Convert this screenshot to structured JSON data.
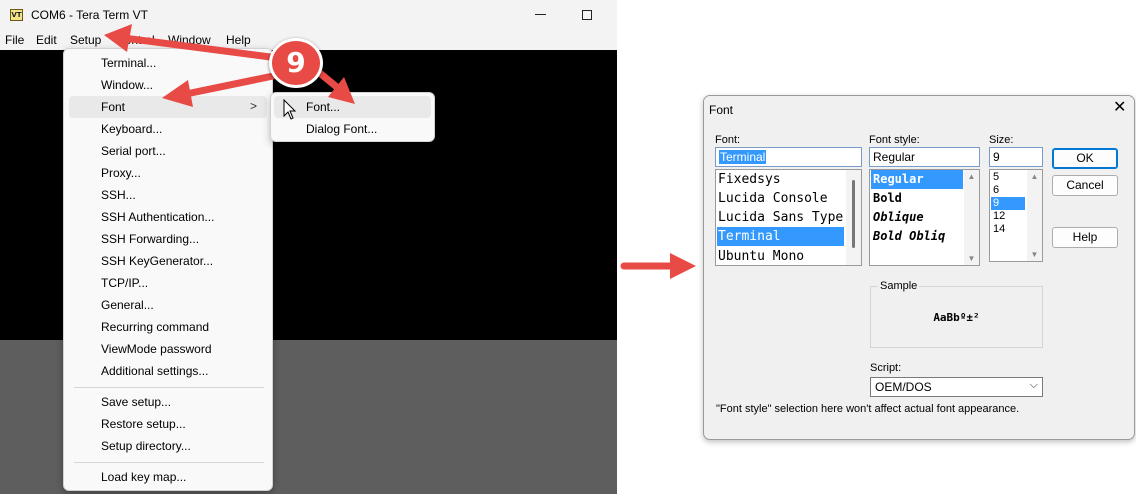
{
  "tera_term": {
    "title": "COM6 - Tera Term VT",
    "app_icon_text": "VT",
    "menubar": [
      "File",
      "Edit",
      "Setup",
      "Control",
      "Window",
      "Help"
    ],
    "setup_menu": {
      "group1": [
        "Terminal...",
        "Window...",
        "Font",
        "Keyboard...",
        "Serial port...",
        "Proxy...",
        "SSH...",
        "SSH Authentication...",
        "SSH Forwarding...",
        "SSH KeyGenerator...",
        "TCP/IP...",
        "General...",
        "Recurring command",
        "ViewMode password",
        "Additional settings..."
      ],
      "group2": [
        "Save setup...",
        "Restore setup...",
        "Setup directory..."
      ],
      "group3": [
        "Load key map..."
      ],
      "submenu_arrow": ">"
    },
    "font_submenu": [
      "Font...",
      "Dialog Font..."
    ]
  },
  "annotation": {
    "step_number": "9",
    "arrow_color": "#e84a45"
  },
  "font_dialog": {
    "title": "Font",
    "close_glyph": "✕",
    "font_label": "Font:",
    "font_value": "Terminal",
    "fonts": [
      "Fixedsys",
      "Lucida Console",
      "Lucida Sans Type",
      "Terminal",
      "Ubuntu Mono"
    ],
    "selected_font": "Terminal",
    "style_label": "Font style:",
    "style_value": "Regular",
    "styles": [
      "Regular",
      "Bold",
      "Oblique",
      "Bold Obliq"
    ],
    "selected_style": "Regular",
    "size_label": "Size:",
    "size_value": "9",
    "sizes": [
      "5",
      "6",
      "9",
      "12",
      "14"
    ],
    "selected_size": "9",
    "ok_label": "OK",
    "cancel_label": "Cancel",
    "help_label": "Help",
    "sample_label": "Sample",
    "sample_text": "AaBbº±²",
    "script_label": "Script:",
    "script_value": "OEM/DOS",
    "note": "\"Font style\" selection here won't affect actual font appearance."
  }
}
